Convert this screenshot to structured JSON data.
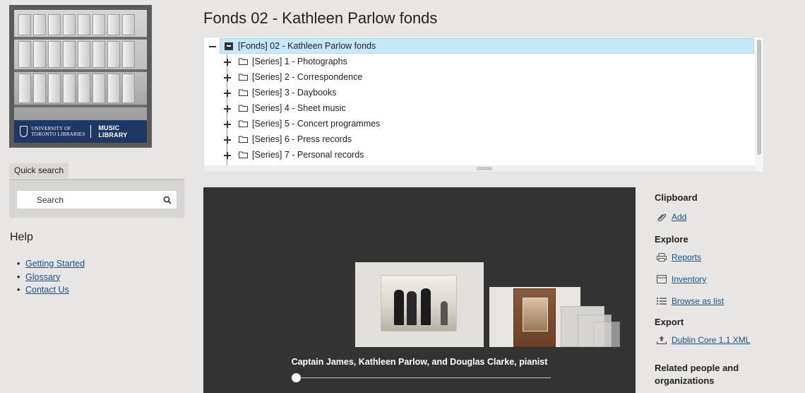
{
  "logo": {
    "university_text": "UNIVERSITY OF TORONTO LIBRARIES",
    "library_name": "MUSIC LIBRARY"
  },
  "quick_search": {
    "label": "Quick search",
    "placeholder": "Search"
  },
  "help": {
    "title": "Help",
    "links": [
      "Getting Started",
      "Glossary",
      "Contact Us"
    ]
  },
  "page_title": "Fonds 02 - Kathleen Parlow fonds",
  "tree": {
    "root": "[Fonds] 02 - Kathleen Parlow fonds",
    "children": [
      "[Series] 1 - Photographs",
      "[Series] 2 - Correspondence",
      "[Series] 3 - Daybooks",
      "[Series] 4 - Sheet music",
      "[Series] 5 - Concert programmes",
      "[Series] 6 - Press records",
      "[Series] 7 - Personal records"
    ]
  },
  "viewer": {
    "caption": "Captain James, Kathleen Parlow, and Douglas Clarke, pianist",
    "slider_position": 0
  },
  "sidebar": {
    "clipboard": {
      "heading": "Clipboard",
      "add": "Add"
    },
    "explore": {
      "heading": "Explore",
      "reports": "Reports",
      "inventory": "Inventory",
      "browse": "Browse as list"
    },
    "export": {
      "heading": "Export",
      "dublin_core": "Dublin Core 1.1 XML"
    },
    "related": {
      "heading": "Related people and organizations"
    }
  },
  "colors": {
    "background": "#e8e6e4",
    "link": "#1e4f86",
    "selected_row": "#c6e7f8",
    "viewer_bg": "#333333",
    "brand_navy": "#1e3765"
  }
}
